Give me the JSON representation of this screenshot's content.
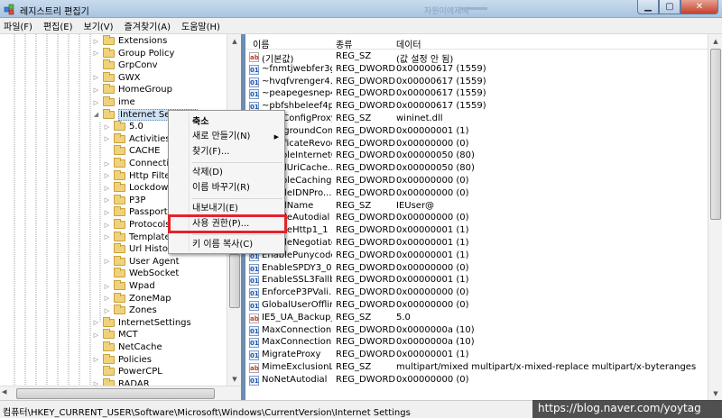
{
  "window": {
    "title": "레지스트리 편집기",
    "ghost_text": "자원이에제예"
  },
  "menubar": [
    "파일(F)",
    "편집(E)",
    "보기(V)",
    "즐겨찾기(A)",
    "도움말(H)"
  ],
  "tree": [
    {
      "label": "Extensions",
      "depth": 1,
      "expander": "▷"
    },
    {
      "label": "Group Policy",
      "depth": 1,
      "expander": "▷"
    },
    {
      "label": "GrpConv",
      "depth": 1,
      "expander": ""
    },
    {
      "label": "GWX",
      "depth": 1,
      "expander": "▷"
    },
    {
      "label": "HomeGroup",
      "depth": 1,
      "expander": "▷"
    },
    {
      "label": "ime",
      "depth": 1,
      "expander": "▷"
    },
    {
      "label": "Internet Settings",
      "depth": 1,
      "expander": "◢",
      "selected": true
    },
    {
      "label": "5.0",
      "depth": 2,
      "expander": "▷"
    },
    {
      "label": "Activities",
      "depth": 2,
      "expander": "▷"
    },
    {
      "label": "CACHE",
      "depth": 2,
      "expander": ""
    },
    {
      "label": "Connections",
      "depth": 2,
      "expander": "▷"
    },
    {
      "label": "Http Filters",
      "depth": 2,
      "expander": "▷"
    },
    {
      "label": "Lockdown_Zones",
      "depth": 2,
      "expander": "▷"
    },
    {
      "label": "P3P",
      "depth": 2,
      "expander": "▷"
    },
    {
      "label": "Passport",
      "depth": 2,
      "expander": "▷"
    },
    {
      "label": "Protocols",
      "depth": 2,
      "expander": "▷"
    },
    {
      "label": "TemplatePolicies",
      "depth": 2,
      "expander": "▷"
    },
    {
      "label": "Url History",
      "depth": 2,
      "expander": ""
    },
    {
      "label": "User Agent",
      "depth": 2,
      "expander": "▷"
    },
    {
      "label": "WebSocket",
      "depth": 2,
      "expander": ""
    },
    {
      "label": "Wpad",
      "depth": 2,
      "expander": "▷"
    },
    {
      "label": "ZoneMap",
      "depth": 2,
      "expander": "▷"
    },
    {
      "label": "Zones",
      "depth": 2,
      "expander": "▷"
    },
    {
      "label": "InternetSettings",
      "depth": 1,
      "expander": "▷"
    },
    {
      "label": "MCT",
      "depth": 1,
      "expander": "▷"
    },
    {
      "label": "NetCache",
      "depth": 1,
      "expander": ""
    },
    {
      "label": "Policies",
      "depth": 1,
      "expander": "▷"
    },
    {
      "label": "PowerCPL",
      "depth": 1,
      "expander": ""
    },
    {
      "label": "RADAR",
      "depth": 1,
      "expander": "▷"
    }
  ],
  "columns": {
    "name": "이름",
    "type": "종류",
    "data": "데이터"
  },
  "values": [
    {
      "icon": "sz",
      "name": "(기본값)",
      "type": "REG_SZ",
      "data": "(값 설정 안 됨)"
    },
    {
      "icon": "dw",
      "name": "~fnmtjwebfer3g...",
      "type": "REG_DWORD",
      "data": "0x00000617 (1559)"
    },
    {
      "icon": "dw",
      "name": "~hvqfvrenger4...",
      "type": "REG_DWORD",
      "data": "0x00000617 (1559)"
    },
    {
      "icon": "dw",
      "name": "~peapegesnep4...",
      "type": "REG_DWORD",
      "data": "0x00000617 (1559)"
    },
    {
      "icon": "dw",
      "name": "~pbfshbeleef4p...",
      "type": "REG_DWORD",
      "data": "0x00000617 (1559)"
    },
    {
      "icon": "sz",
      "name": "AutoConfigProxy",
      "type": "REG_SZ",
      "data": "wininet.dll"
    },
    {
      "icon": "dw",
      "name": "BackgroundCon...",
      "type": "REG_DWORD",
      "data": "0x00000001 (1)"
    },
    {
      "icon": "dw",
      "name": "CertificateRevoc...",
      "type": "REG_DWORD",
      "data": "0x00000000 (0)"
    },
    {
      "icon": "dw",
      "name": "DisableInternetCom...",
      "type": "REG_DWORD",
      "data": "0x00000050 (80)"
    },
    {
      "icon": "dw",
      "name": "EmailUriCache...",
      "type": "REG_DWORD",
      "data": "0x00000050 (80)"
    },
    {
      "icon": "dw",
      "name": "DisableCaching...",
      "type": "REG_DWORD",
      "data": "0x00000000 (0)"
    },
    {
      "icon": "dw",
      "name": "EnableIDNPro...",
      "type": "REG_DWORD",
      "data": "0x00000000 (0)"
    },
    {
      "icon": "sz",
      "name": "EmailName",
      "type": "REG_SZ",
      "data": "IEUser@"
    },
    {
      "icon": "dw",
      "name": "EnableAutodial",
      "type": "REG_DWORD",
      "data": "0x00000000 (0)"
    },
    {
      "icon": "dw",
      "name": "EnableHttp1_1",
      "type": "REG_DWORD",
      "data": "0x00000001 (1)"
    },
    {
      "icon": "dw",
      "name": "EnableNegotiate",
      "type": "REG_DWORD",
      "data": "0x00000001 (1)"
    },
    {
      "icon": "dw",
      "name": "EnablePunycode",
      "type": "REG_DWORD",
      "data": "0x00000001 (1)"
    },
    {
      "icon": "dw",
      "name": "EnableSPDY3_0",
      "type": "REG_DWORD",
      "data": "0x00000000 (0)"
    },
    {
      "icon": "dw",
      "name": "EnableSSL3Fallb...",
      "type": "REG_DWORD",
      "data": "0x00000001 (1)"
    },
    {
      "icon": "dw",
      "name": "EnforceP3PVali...",
      "type": "REG_DWORD",
      "data": "0x00000000 (0)"
    },
    {
      "icon": "dw",
      "name": "GlobalUserOffline",
      "type": "REG_DWORD",
      "data": "0x00000000 (0)"
    },
    {
      "icon": "sz",
      "name": "IE5_UA_Backup_...",
      "type": "REG_SZ",
      "data": "5.0"
    },
    {
      "icon": "dw",
      "name": "MaxConnection...",
      "type": "REG_DWORD",
      "data": "0x0000000a (10)"
    },
    {
      "icon": "dw",
      "name": "MaxConnection...",
      "type": "REG_DWORD",
      "data": "0x0000000a (10)"
    },
    {
      "icon": "dw",
      "name": "MigrateProxy",
      "type": "REG_DWORD",
      "data": "0x00000001 (1)"
    },
    {
      "icon": "sz",
      "name": "MimeExclusionL...",
      "type": "REG_SZ",
      "data": "multipart/mixed multipart/x-mixed-replace multipart/x-byteranges"
    },
    {
      "icon": "dw",
      "name": "NoNetAutodial",
      "type": "REG_DWORD",
      "data": "0x00000000 (0)"
    }
  ],
  "context_menu": {
    "items": [
      {
        "label": "축소",
        "bold": true
      },
      {
        "label": "새로 만들기(N)",
        "submenu": true
      },
      {
        "label": "찾기(F)..."
      },
      {
        "sep": true
      },
      {
        "label": "삭제(D)"
      },
      {
        "label": "이름 바꾸기(R)"
      },
      {
        "sep": true
      },
      {
        "label": "내보내기(E)"
      },
      {
        "label": "사용 권한(P)...",
        "highlighted": true
      },
      {
        "sep": true
      },
      {
        "label": "키 이름 복사(C)"
      }
    ],
    "highlight_color": "#e3232c"
  },
  "statusbar": {
    "path": "컴퓨터\\HKEY_CURRENT_USER\\Software\\Microsoft\\Windows\\CurrentVersion\\Internet Settings"
  },
  "watermark": "https://blog.naver.com/yoytag"
}
